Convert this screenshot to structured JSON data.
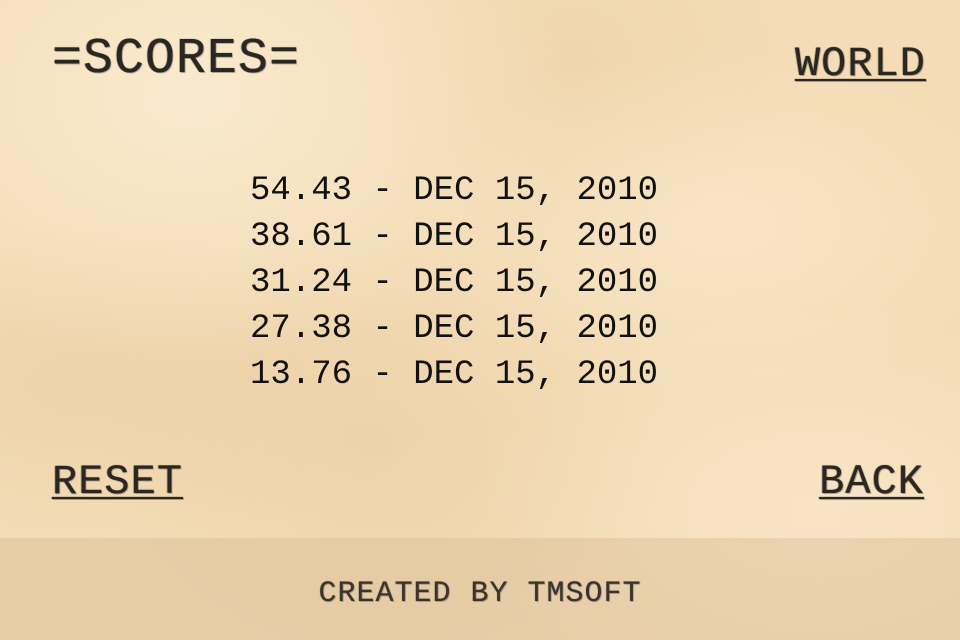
{
  "header": {
    "title": "=SCORES=",
    "world_label": "WORLD"
  },
  "scores": [
    {
      "score": "54.43",
      "date": "DEC 15, 2010"
    },
    {
      "score": "38.61",
      "date": "DEC 15, 2010"
    },
    {
      "score": "31.24",
      "date": "DEC 15, 2010"
    },
    {
      "score": "27.38",
      "date": "DEC 15, 2010"
    },
    {
      "score": "13.76",
      "date": "DEC 15, 2010"
    }
  ],
  "separator": " - ",
  "buttons": {
    "reset_label": "RESET",
    "back_label": "BACK"
  },
  "footer": {
    "credit": "CREATED BY TMSOFT"
  },
  "colors": {
    "paper": "#f3dcb6",
    "ink": "#111111"
  }
}
